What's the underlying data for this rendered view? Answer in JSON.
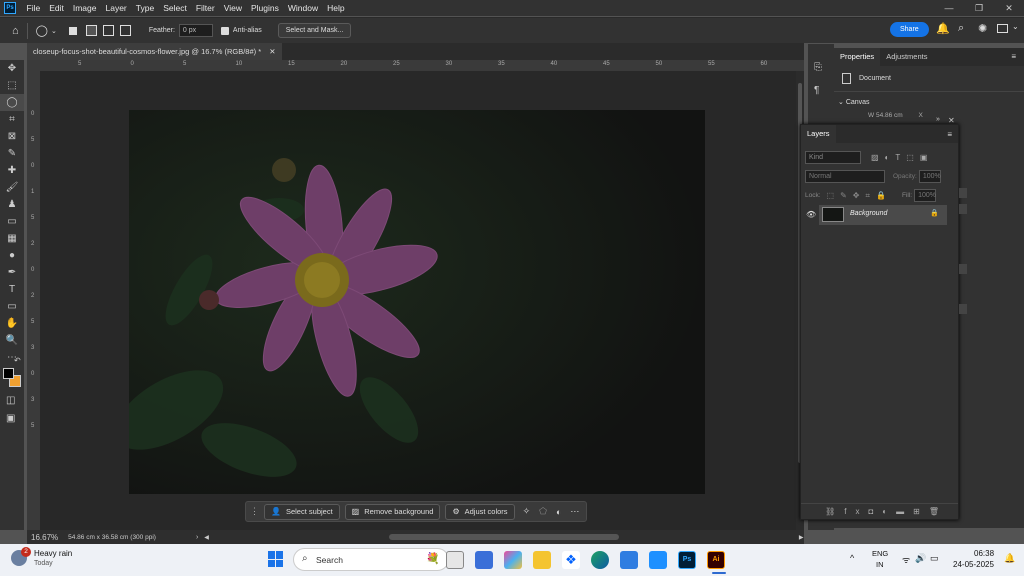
{
  "menu": [
    "File",
    "Edit",
    "Image",
    "Layer",
    "Type",
    "Select",
    "Filter",
    "View",
    "Plugins",
    "Window",
    "Help"
  ],
  "app_icon": "Ps",
  "options": {
    "feather_label": "Feather:",
    "feather_value": "0 px",
    "anti_alias": "Anti-alias",
    "select_mask": "Select and Mask...",
    "share": "Share"
  },
  "document": {
    "tab_title": "closeup-focus-shot-beautiful-cosmos-flower.jpg @ 16.7% (RGB/8#) *",
    "zoom": "16.67%",
    "dimensions": "54.86 cm x 36.58 cm (300 ppi)"
  },
  "ruler_h": [
    "5",
    "0",
    "5",
    "10",
    "15",
    "20",
    "25",
    "30",
    "35",
    "40",
    "45",
    "50",
    "55",
    "60"
  ],
  "ruler_v": [
    "0",
    "5",
    "0",
    "1",
    "5",
    "2",
    "0",
    "2",
    "5",
    "3",
    "0",
    "3",
    "5"
  ],
  "context": {
    "select_subject": "Select subject",
    "remove_background": "Remove background",
    "adjust_colors": "Adjust colors"
  },
  "properties": {
    "tab1": "Properties",
    "tab2": "Adjustments",
    "document": "Document",
    "canvas": "Canvas",
    "w_label": "W",
    "w_value": "54.86 cm",
    "x_label": "X"
  },
  "layers": {
    "title": "Layers",
    "kind": "Kind",
    "mode": "Normal",
    "opacity_label": "Opacity:",
    "opacity": "100%",
    "lock_label": "Lock:",
    "fill_label": "Fill:",
    "fill": "100%",
    "layer_name": "Background"
  },
  "weather": {
    "badge": "2",
    "title": "Heavy rain",
    "sub": "Today"
  },
  "taskbar": {
    "search": "Search",
    "lang1": "ENG",
    "lang2": "IN",
    "time": "06:38",
    "date": "24-05-2025"
  },
  "colors": {
    "ps_blue": "#31a8ff",
    "share": "#1473e6",
    "fg": "#000000",
    "bg": "#f0a030"
  }
}
